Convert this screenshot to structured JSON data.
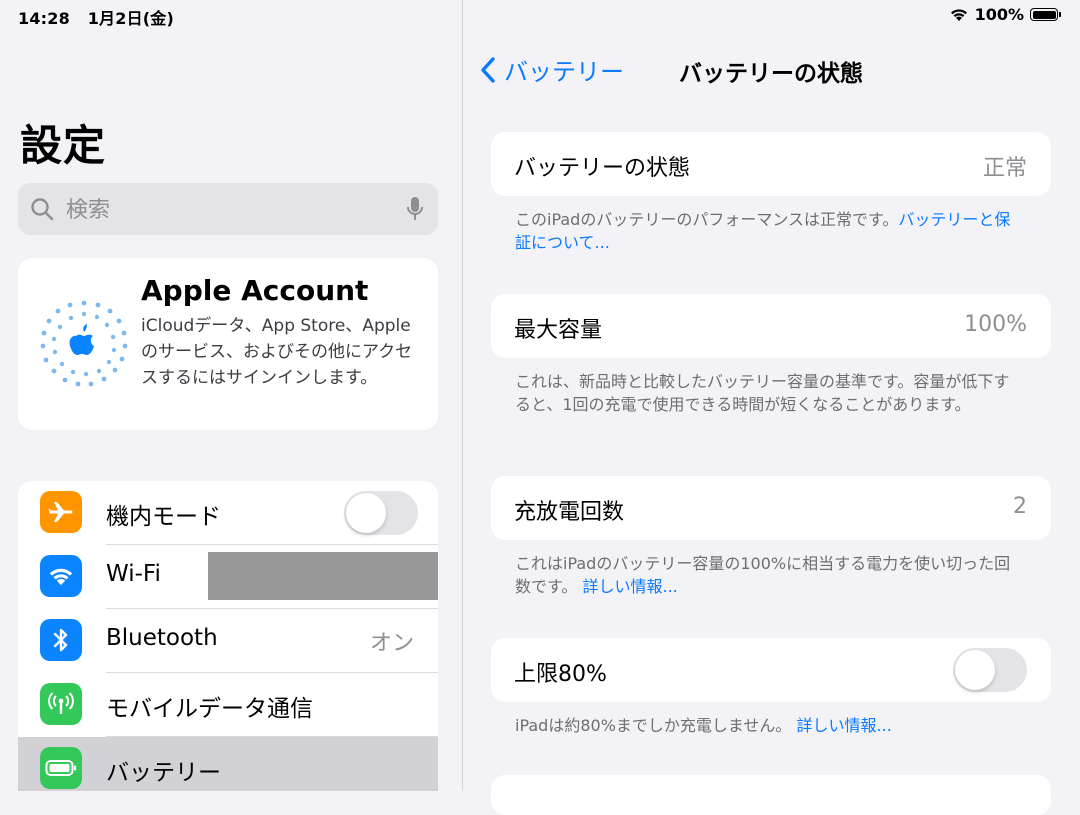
{
  "status_bar": {
    "time": "14:28",
    "date": "1月2日(金)",
    "battery_percent": "100%"
  },
  "sidebar": {
    "title": "設定",
    "search": {
      "placeholder": "検索"
    },
    "account": {
      "name": "Apple Account",
      "description": "iCloudデータ、App Store、Appleのサービス、およびその他にアクセスするにはサインインします。"
    },
    "items": [
      {
        "label": "機内モード",
        "icon": "airplane-icon",
        "color": "#ff9500",
        "toggle_on": false
      },
      {
        "label": "Wi-Fi",
        "icon": "wifi-icon",
        "color": "#0a84ff",
        "value_redacted": true
      },
      {
        "label": "Bluetooth",
        "icon": "bluetooth-icon",
        "color": "#0a84ff",
        "value": "オン"
      },
      {
        "label": "モバイルデータ通信",
        "icon": "antenna-icon",
        "color": "#34c759"
      },
      {
        "label": "バッテリー",
        "icon": "battery-icon",
        "color": "#34c759",
        "selected": true
      }
    ]
  },
  "detail": {
    "back_label": "バッテリー",
    "title": "バッテリーの状態",
    "health": {
      "label": "バッテリーの状態",
      "value": "正常",
      "footnote_text": "このiPadのバッテリーのパフォーマンスは正常です。",
      "footnote_link": "バッテリーと保証について..."
    },
    "capacity": {
      "label": "最大容量",
      "value": "100%",
      "footnote_text": "これは、新品時と比較したバッテリー容量の基準です。容量が低下すると、1回の充電で使用できる時間が短くなることがあります。"
    },
    "cycles": {
      "label": "充放電回数",
      "value": "2",
      "footnote_text": "これはiPadのバッテリー容量の100%に相当する電力を使い切った回数です。",
      "footnote_link": "詳しい情報..."
    },
    "limit": {
      "label": "上限80%",
      "toggle_on": false,
      "footnote_text": "iPadは約80%までしか充電しません。",
      "footnote_link": "詳しい情報..."
    }
  },
  "colors": {
    "accent": "#0a7aff",
    "background": "#f2f2f7",
    "selected_row": "#d1d1d6"
  }
}
